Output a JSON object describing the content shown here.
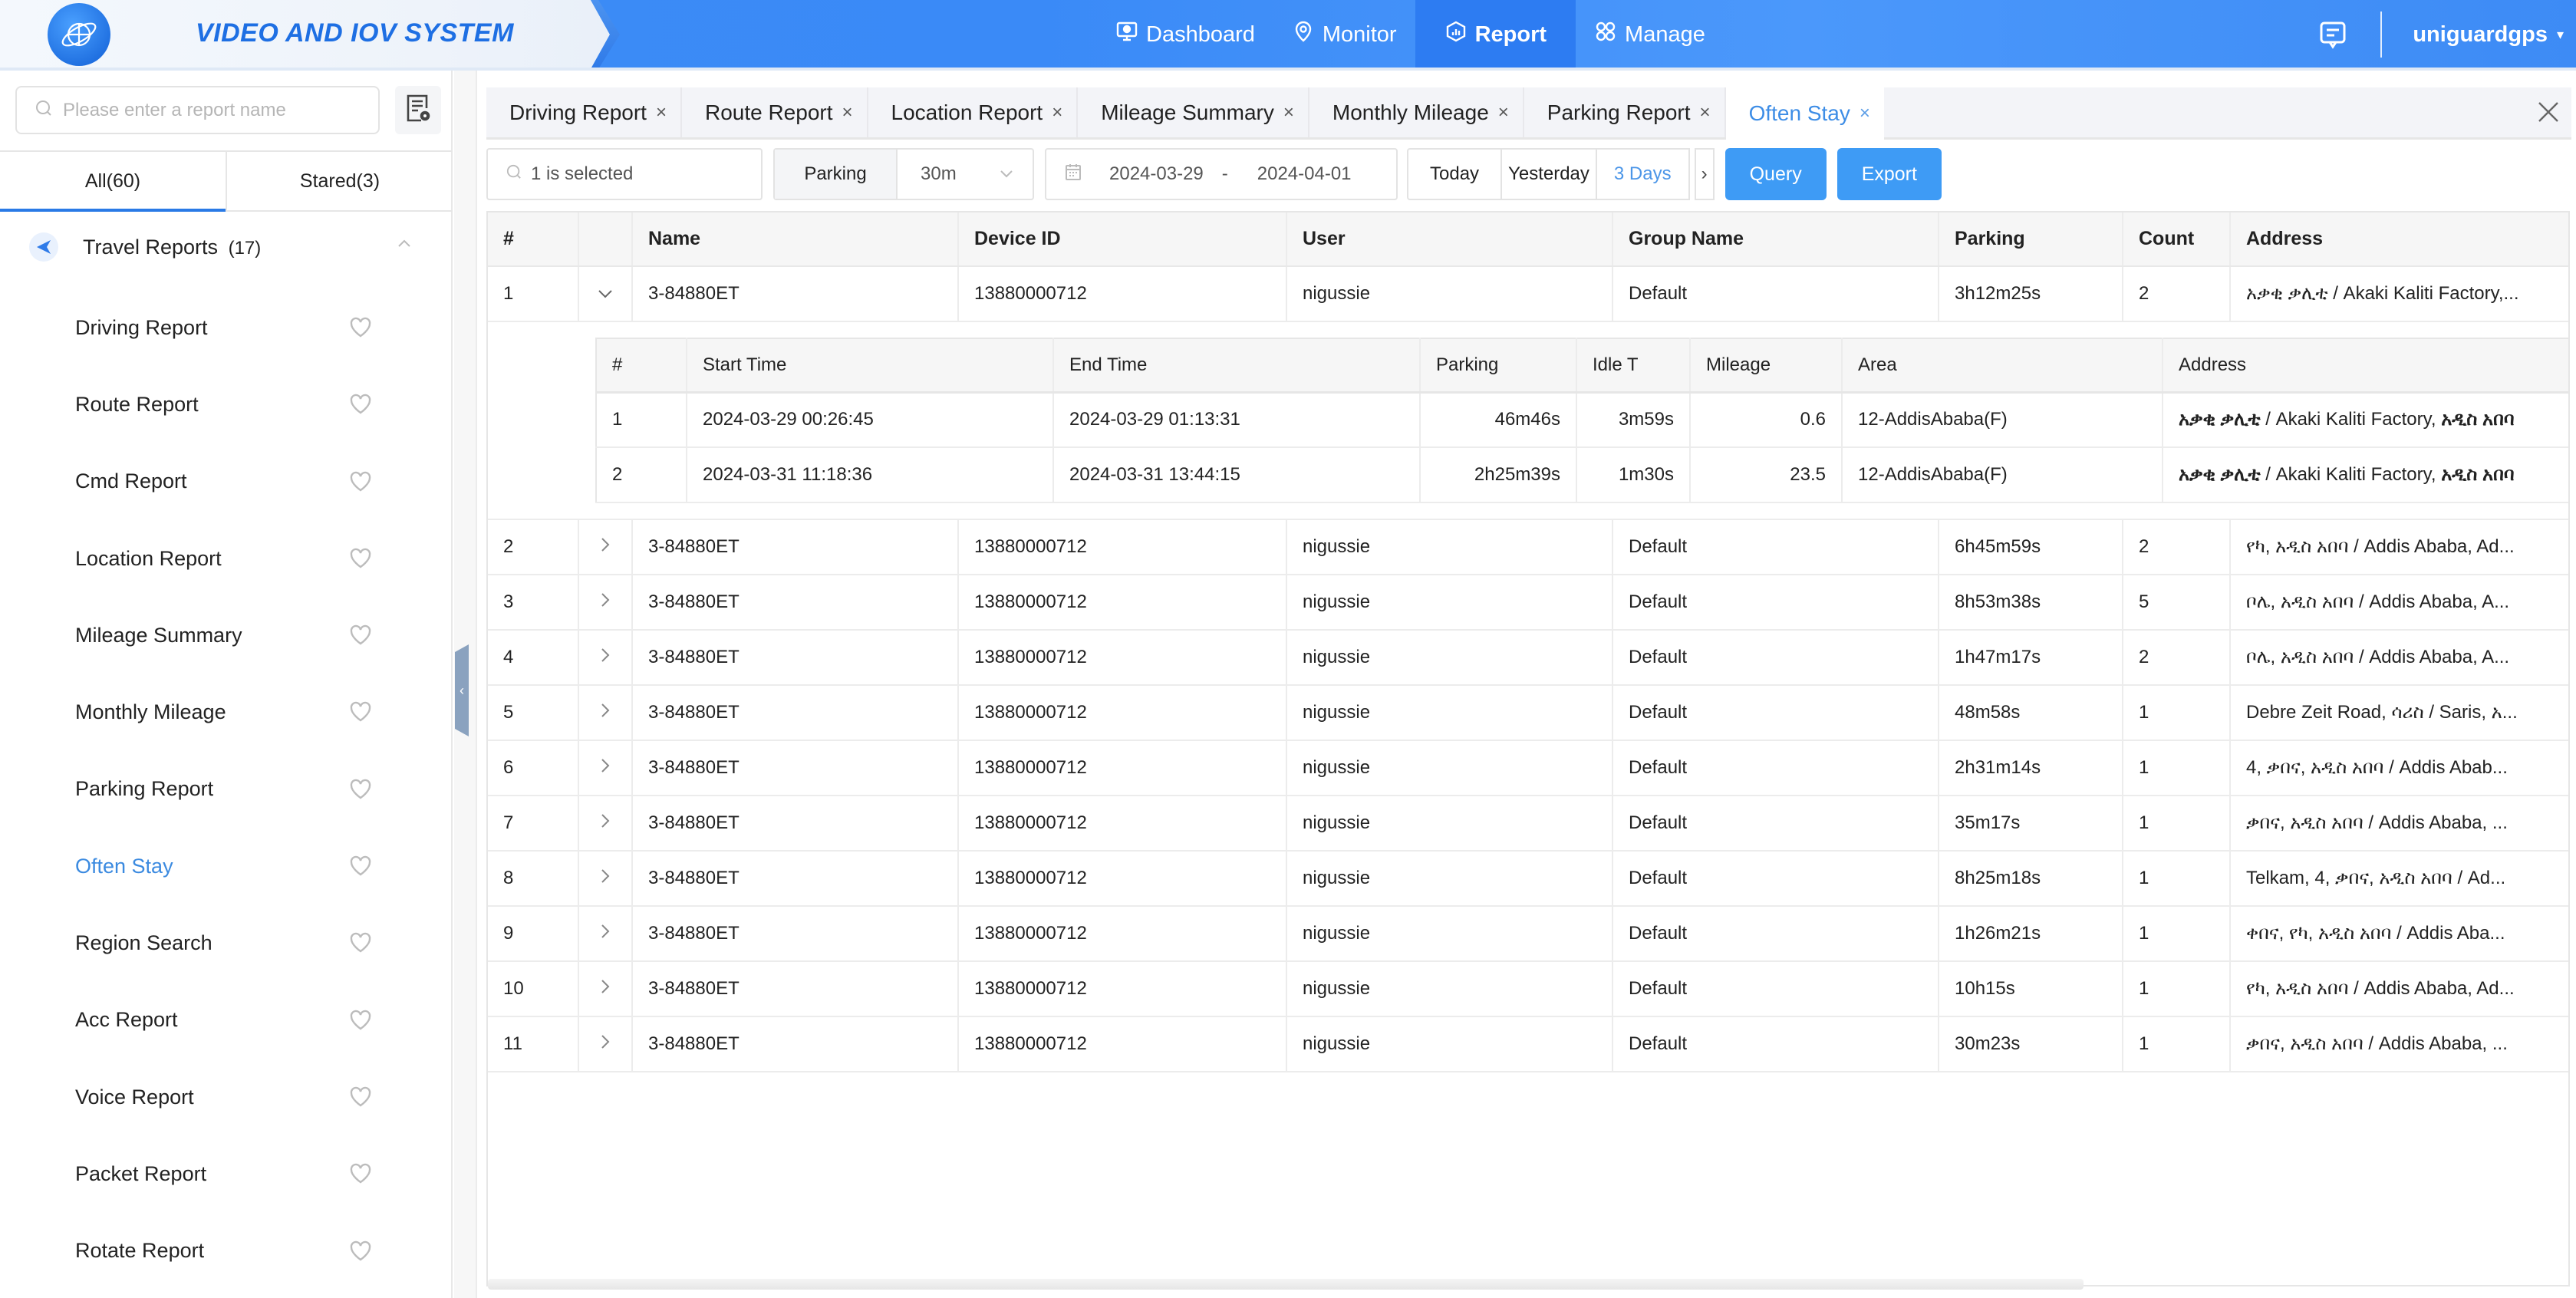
{
  "header": {
    "brand_title": "VIDEO AND IOV SYSTEM",
    "nav": [
      {
        "label": "Dashboard",
        "icon": "dashboard-icon",
        "active": false
      },
      {
        "label": "Monitor",
        "icon": "location-pin-icon",
        "active": false
      },
      {
        "label": "Report",
        "icon": "report-icon",
        "active": true
      },
      {
        "label": "Manage",
        "icon": "manage-icon",
        "active": false
      }
    ],
    "user_name": "uniguardgps",
    "user_caret": "▾",
    "colors": {
      "accent": "#3a8af7",
      "active_nav": "#2d7cf2"
    }
  },
  "sidebar": {
    "search_placeholder": "Please enter a report name",
    "tabs": [
      {
        "label": "All(60)",
        "active": true
      },
      {
        "label": "Stared(3)",
        "active": false
      }
    ],
    "group": {
      "title": "Travel Reports",
      "count": "(17)"
    },
    "items": [
      {
        "label": "Driving Report",
        "active": false
      },
      {
        "label": "Route Report",
        "active": false
      },
      {
        "label": "Cmd Report",
        "active": false
      },
      {
        "label": "Location Report",
        "active": false
      },
      {
        "label": "Mileage Summary",
        "active": false
      },
      {
        "label": "Monthly Mileage",
        "active": false
      },
      {
        "label": "Parking Report",
        "active": false
      },
      {
        "label": "Often Stay",
        "active": true
      },
      {
        "label": "Region Search",
        "active": false
      },
      {
        "label": "Acc Report",
        "active": false
      },
      {
        "label": "Voice Report",
        "active": false
      },
      {
        "label": "Packet Report",
        "active": false
      },
      {
        "label": "Rotate Report",
        "active": false
      }
    ]
  },
  "tabs": [
    {
      "label": "Driving Report",
      "active": false
    },
    {
      "label": "Route Report",
      "active": false
    },
    {
      "label": "Location Report",
      "active": false
    },
    {
      "label": "Mileage Summary",
      "active": false
    },
    {
      "label": "Monthly Mileage",
      "active": false
    },
    {
      "label": "Parking Report",
      "active": false
    },
    {
      "label": "Often Stay",
      "active": true
    }
  ],
  "tab_close_glyph": "×",
  "toolbar": {
    "device_select_value": "1 is selected",
    "mode_label": "Parking",
    "mode_value": "30m",
    "date_start": "2024-03-29",
    "date_sep": "-",
    "date_end": "2024-04-01",
    "quick": [
      {
        "label": "Today",
        "active": false
      },
      {
        "label": "Yesterday",
        "active": false
      },
      {
        "label": "3 Days",
        "active": true
      }
    ],
    "next_glyph": "›",
    "query_label": "Query",
    "export_label": "Export"
  },
  "table": {
    "columns": [
      "#",
      "",
      "Name",
      "Device ID",
      "User",
      "Group Name",
      "Parking",
      "Count",
      "Address"
    ],
    "rows": [
      {
        "idx": "1",
        "expanded": true,
        "name": "3-84880ET",
        "device_id": "13880000712",
        "user": "nigussie",
        "group": "Default",
        "parking": "3h12m25s",
        "count": "2",
        "address": "አቃቂ ቃሊቲ / Akaki Kaliti Factory,..."
      },
      {
        "idx": "2",
        "expanded": false,
        "name": "3-84880ET",
        "device_id": "13880000712",
        "user": "nigussie",
        "group": "Default",
        "parking": "6h45m59s",
        "count": "2",
        "address": "የካ, አዲስ አበባ / Addis Ababa, Ad..."
      },
      {
        "idx": "3",
        "expanded": false,
        "name": "3-84880ET",
        "device_id": "13880000712",
        "user": "nigussie",
        "group": "Default",
        "parking": "8h53m38s",
        "count": "5",
        "address": "ቦሌ, አዲስ አበባ / Addis Ababa, A..."
      },
      {
        "idx": "4",
        "expanded": false,
        "name": "3-84880ET",
        "device_id": "13880000712",
        "user": "nigussie",
        "group": "Default",
        "parking": "1h47m17s",
        "count": "2",
        "address": "ቦሌ, አዲስ አበባ / Addis Ababa, A..."
      },
      {
        "idx": "5",
        "expanded": false,
        "name": "3-84880ET",
        "device_id": "13880000712",
        "user": "nigussie",
        "group": "Default",
        "parking": "48m58s",
        "count": "1",
        "address": "Debre Zeit Road, ሳሪስ / Saris, አ..."
      },
      {
        "idx": "6",
        "expanded": false,
        "name": "3-84880ET",
        "device_id": "13880000712",
        "user": "nigussie",
        "group": "Default",
        "parking": "2h31m14s",
        "count": "1",
        "address": "4, ቃበና, አዲስ አበባ / Addis Abab..."
      },
      {
        "idx": "7",
        "expanded": false,
        "name": "3-84880ET",
        "device_id": "13880000712",
        "user": "nigussie",
        "group": "Default",
        "parking": "35m17s",
        "count": "1",
        "address": "ቃበና, አዲስ አበባ / Addis Ababa, ..."
      },
      {
        "idx": "8",
        "expanded": false,
        "name": "3-84880ET",
        "device_id": "13880000712",
        "user": "nigussie",
        "group": "Default",
        "parking": "8h25m18s",
        "count": "1",
        "address": "Telkam, 4, ቃበና, አዲስ አበባ / Ad..."
      },
      {
        "idx": "9",
        "expanded": false,
        "name": "3-84880ET",
        "device_id": "13880000712",
        "user": "nigussie",
        "group": "Default",
        "parking": "1h26m21s",
        "count": "1",
        "address": "ቀበና, የካ, አዲስ አበባ / Addis Aba..."
      },
      {
        "idx": "10",
        "expanded": false,
        "name": "3-84880ET",
        "device_id": "13880000712",
        "user": "nigussie",
        "group": "Default",
        "parking": "10h15s",
        "count": "1",
        "address": "የካ, አዲስ አበባ / Addis Ababa, Ad..."
      },
      {
        "idx": "11",
        "expanded": false,
        "name": "3-84880ET",
        "device_id": "13880000712",
        "user": "nigussie",
        "group": "Default",
        "parking": "30m23s",
        "count": "1",
        "address": "ቃበና, አዲስ አበባ / Addis Ababa, ..."
      }
    ],
    "detail": {
      "columns": [
        "#",
        "Start Time",
        "End Time",
        "Parking",
        "Idle T",
        "Mileage",
        "Area",
        "Address"
      ],
      "rows": [
        {
          "idx": "1",
          "start": "2024-03-29 00:26:45",
          "end": "2024-03-29 01:13:31",
          "parking": "46m46s",
          "idle": "3m59s",
          "mileage": "0.6",
          "area": "12-AddisAbaba(F)",
          "addr_bold1": "አቃቂ ቃሊቲ",
          "addr_mid": " / Akaki Kaliti Factory, ",
          "addr_bold2": "አዲስ አበባ"
        },
        {
          "idx": "2",
          "start": "2024-03-31 11:18:36",
          "end": "2024-03-31 13:44:15",
          "parking": "2h25m39s",
          "idle": "1m30s",
          "mileage": "23.5",
          "area": "12-AddisAbaba(F)",
          "addr_bold1": "አቃቂ ቃሊቲ",
          "addr_mid": " / Akaki Kaliti Factory, ",
          "addr_bold2": "አዲስ አበባ"
        }
      ]
    }
  }
}
